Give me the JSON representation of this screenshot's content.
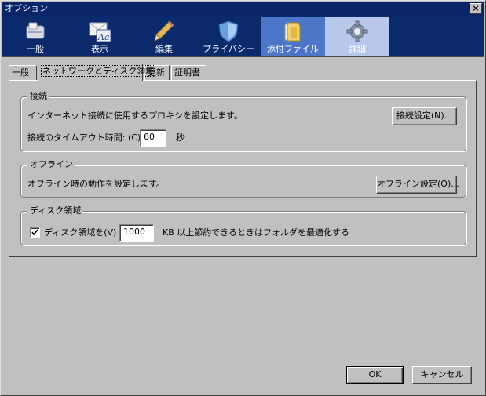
{
  "window": {
    "title": "オプション",
    "close_glyph": "×"
  },
  "toolbar": {
    "items": [
      {
        "label": "一般",
        "icon": "general-icon"
      },
      {
        "label": "表示",
        "icon": "display-icon"
      },
      {
        "label": "編集",
        "icon": "edit-pencil-icon"
      },
      {
        "label": "プライバシー",
        "icon": "shield-icon"
      },
      {
        "label": "添付ファイル",
        "icon": "folder-icon"
      },
      {
        "label": "詳細",
        "icon": "gear-icon",
        "selected": true
      }
    ],
    "colors": {
      "background": "#0a2a6c",
      "hover": "#4d76c9",
      "selected": "#b7c8ea"
    }
  },
  "tabs": [
    {
      "label": "一般"
    },
    {
      "label": "ネットワークとディスク領域",
      "selected": true
    },
    {
      "label": "更新"
    },
    {
      "label": "証明書"
    }
  ],
  "connection": {
    "legend": "接続",
    "description": "インターネット接続に使用するプロキシを設定します。",
    "settings_button": "接続設定(N)...",
    "timeout_label": "接続のタイムアウト時間: (C)",
    "timeout_value": "60",
    "timeout_unit": "秒"
  },
  "offline": {
    "legend": "オフライン",
    "description": "オフライン時の動作を設定します。",
    "settings_button": "オフライン設定(O)..."
  },
  "disk": {
    "legend": "ディスク領域",
    "checkbox_label": "ディスク領域を(V)",
    "checked": true,
    "value": "1000",
    "suffix": "KB 以上節約できるときはフォルダを最適化する"
  },
  "footer": {
    "ok": "OK",
    "cancel": "キャンセル"
  }
}
